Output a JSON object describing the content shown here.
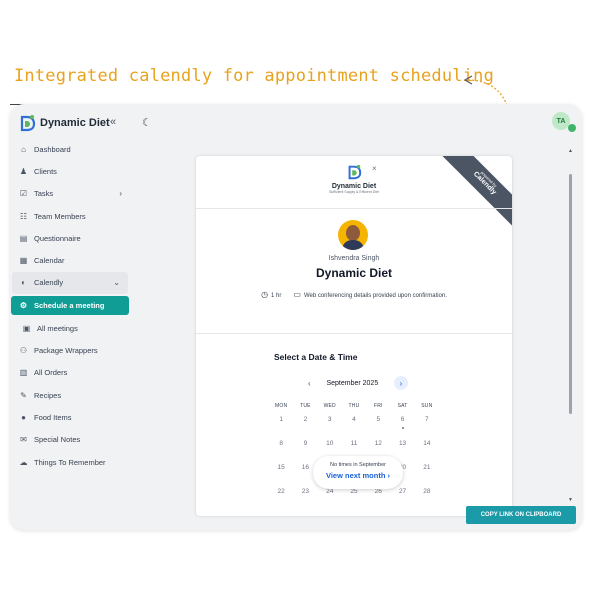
{
  "annotation": {
    "text": "Integrated calendly for appointment scheduling",
    "color": "#e8a21d"
  },
  "app": {
    "name": "Dynamic Diet",
    "collapse_icon": "double-chevron-left-icon",
    "theme_icon": "moon-icon",
    "user_initials": "TA"
  },
  "sidebar": {
    "items": [
      {
        "label": "Dashboard",
        "icon": "home-icon"
      },
      {
        "label": "Clients",
        "icon": "user-icon"
      },
      {
        "label": "Tasks",
        "icon": "checkbox-icon"
      },
      {
        "label": "Team Members",
        "icon": "users-icon"
      },
      {
        "label": "Questionnaire",
        "icon": "clipboard-icon"
      },
      {
        "label": "Calendar",
        "icon": "calendar-icon"
      },
      {
        "label": "Calendly",
        "icon": "calendly-icon"
      },
      {
        "label": "Schedule a meeting",
        "icon": "gear-icon"
      },
      {
        "label": "All meetings",
        "icon": "list-icon"
      },
      {
        "label": "Package Wrappers",
        "icon": "sitemap-icon"
      },
      {
        "label": "All Orders",
        "icon": "orders-icon"
      },
      {
        "label": "Recipes",
        "icon": "recipe-icon"
      },
      {
        "label": "Food Items",
        "icon": "apple-icon"
      },
      {
        "label": "Special Notes",
        "icon": "notes-icon"
      },
      {
        "label": "Things To Remember",
        "icon": "brain-icon"
      }
    ]
  },
  "booking": {
    "logo_name": "Dynamic Diet",
    "logo_tagline": "Sufficient Supply & Efficient Diet",
    "ribbon_small": "powered by",
    "ribbon_big": "Calendly",
    "host_name": "Ishvendra Singh",
    "event_name": "Dynamic Diet",
    "duration": "1 hr",
    "location": "Web conferencing details provided upon confirmation.",
    "section_title": "Select a Date & Time",
    "month": "September 2025",
    "weekdays": [
      "MON",
      "TUE",
      "WED",
      "THU",
      "FRI",
      "SAT",
      "SUN"
    ],
    "weeks": [
      [
        "1",
        "2",
        "3",
        "4",
        "5",
        "6",
        "7"
      ],
      [
        "8",
        "9",
        "10",
        "11",
        "12",
        "13",
        "14"
      ],
      [
        "15",
        "16",
        "17",
        "18",
        "19",
        "20",
        "21"
      ],
      [
        "22",
        "23",
        "24",
        "25",
        "26",
        "27",
        "28"
      ]
    ],
    "no_times": "No times in September",
    "view_next": "View next month",
    "accent": "#1a5fd8"
  },
  "copy_button": {
    "label": "COPY LINK ON CLIPBOARD",
    "color": "#1b9aa8"
  },
  "colors": {
    "active_nav": "#0f9d95"
  }
}
